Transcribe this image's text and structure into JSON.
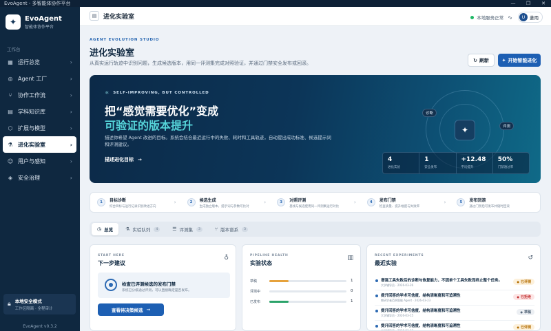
{
  "window": {
    "title": "EvoAgent - 多智能体协作平台",
    "controls": [
      "—",
      "❐",
      "✕"
    ]
  },
  "brand": {
    "name": "EvoAgent",
    "subtitle": "智能体协作平台",
    "icon": "sparkle-icon"
  },
  "sidebar": {
    "section": "工作台",
    "items": [
      {
        "label": "运行总览",
        "icon": "grid-icon",
        "active": false
      },
      {
        "label": "Agent 工厂",
        "icon": "factory-icon",
        "active": false
      },
      {
        "label": "协作工作流",
        "icon": "workflow-icon",
        "active": false
      },
      {
        "label": "学科知识库",
        "icon": "book-icon",
        "active": false
      },
      {
        "label": "扩展与模型",
        "icon": "extension-icon",
        "active": false
      },
      {
        "label": "进化实验室",
        "icon": "lab-icon",
        "active": true
      },
      {
        "label": "用户与感知",
        "icon": "user-icon",
        "active": false
      },
      {
        "label": "安全治理",
        "icon": "shield-icon",
        "active": false
      }
    ],
    "safe_mode": {
      "title": "本地安全模式",
      "subtitle": "工作区隔离 · 全程审计"
    },
    "version": "EvoAgent v0.3.2"
  },
  "topbar": {
    "title": "进化实验室",
    "status": "本地服务正常",
    "user": {
      "initial": "U",
      "name": "菱雨"
    }
  },
  "header": {
    "eyebrow": "AGENT EVOLUTION STUDIO",
    "title": "进化实验室",
    "description": "从真实运行轨迹中识别问题，生成候选版本，用同一评测集完成对照验证，并通过门禁安全发布或回滚。",
    "refresh_label": "刷新",
    "evolve_label": "开始智能进化"
  },
  "hero": {
    "eyebrow": "SELF-IMPROVING, BUT CONTROLLED",
    "title_line1": "把“感觉需要优化”变成",
    "title_line2": "可验证的版本提升",
    "description": "描述你希望 Agent 改进的目标。系统会结合最近运行中的失败、耗时和工具轨迹，自动提出成功标准、候选提示词和评测建议。",
    "link_label": "描述进化目标",
    "orbit_tags": [
      "诊断",
      "评测"
    ],
    "metrics": [
      {
        "value": "4",
        "label": "进化实验"
      },
      {
        "value": "1",
        "label": "安全发布"
      },
      {
        "value": "+12.48",
        "label": "平均提升"
      },
      {
        "value": "50%",
        "label": "门禁通过率"
      }
    ]
  },
  "steps": [
    {
      "num": "1",
      "title": "目标诊断",
      "sub": "综合目标与运行记录识别改进方向"
    },
    {
      "num": "2",
      "title": "候选生成",
      "sub": "生成独立版本，提示词与参数可比对"
    },
    {
      "num": "3",
      "title": "对照评测",
      "sub": "基线与候选使用同一评测集运行对比"
    },
    {
      "num": "4",
      "title": "发布门禁",
      "sub": "检查质量、提升幅度与失败率"
    },
    {
      "num": "5",
      "title": "发布回滚",
      "sub": "通过门禁后可发布并随时回滚"
    }
  ],
  "tabs": [
    {
      "label": "总览",
      "icon": "compass-icon",
      "count": "",
      "active": true
    },
    {
      "label": "实验队列",
      "icon": "flask-icon",
      "count": "4",
      "active": false
    },
    {
      "label": "评测集",
      "icon": "list-icon",
      "count": "3",
      "active": false
    },
    {
      "label": "版本谱系",
      "icon": "branch-icon",
      "count": "3",
      "active": false
    }
  ],
  "next_steps": {
    "eyebrow": "START HERE",
    "title": "下一步建议",
    "item_title": "检查已评测候选的发布门禁",
    "item_sub": "系统已分级通过评测，可以直接确定是否发布。",
    "button_label": "查看待决策候选"
  },
  "pipeline": {
    "eyebrow": "PIPELINE HEALTH",
    "title": "实验状态",
    "rows": [
      {
        "label": "草稿",
        "value": "1",
        "fraction": 0.25,
        "color": "#e6a23c"
      },
      {
        "label": "评测中",
        "value": "0",
        "fraction": 0.0,
        "color": "#2d6ab3"
      },
      {
        "label": "已发布",
        "value": "1",
        "fraction": 0.25,
        "color": "#2ba36a"
      }
    ]
  },
  "experiments": {
    "eyebrow": "RECENT EXPERIMENTS",
    "title": "最近实验",
    "items": [
      {
        "title": "增强工具失败后的诊断与恢复能力，不因单个工具失败而终止整个任务。",
        "sub": "大学辅导员 · 2026-03-26",
        "badge": "已评测",
        "badge_class": "b-eval"
      },
      {
        "title": "提升回答的学术可信度、结构清晰度和可追溯性",
        "sub": "教研学者范例智能 Agent · 2026-03-23",
        "badge": "已拒绝",
        "badge_class": "b-rej"
      },
      {
        "title": "提升回答的学术可信度、结构清晰度和可追溯性",
        "sub": "大学辅导员 · 2026-03-15",
        "badge": "草稿",
        "badge_class": "b-draft"
      },
      {
        "title": "提升回答的学术可信度、结构清晰度和可追溯性",
        "sub": "大学辅导员 · 2026-03-12",
        "badge": "已评测",
        "badge_class": "b-eval"
      }
    ]
  }
}
